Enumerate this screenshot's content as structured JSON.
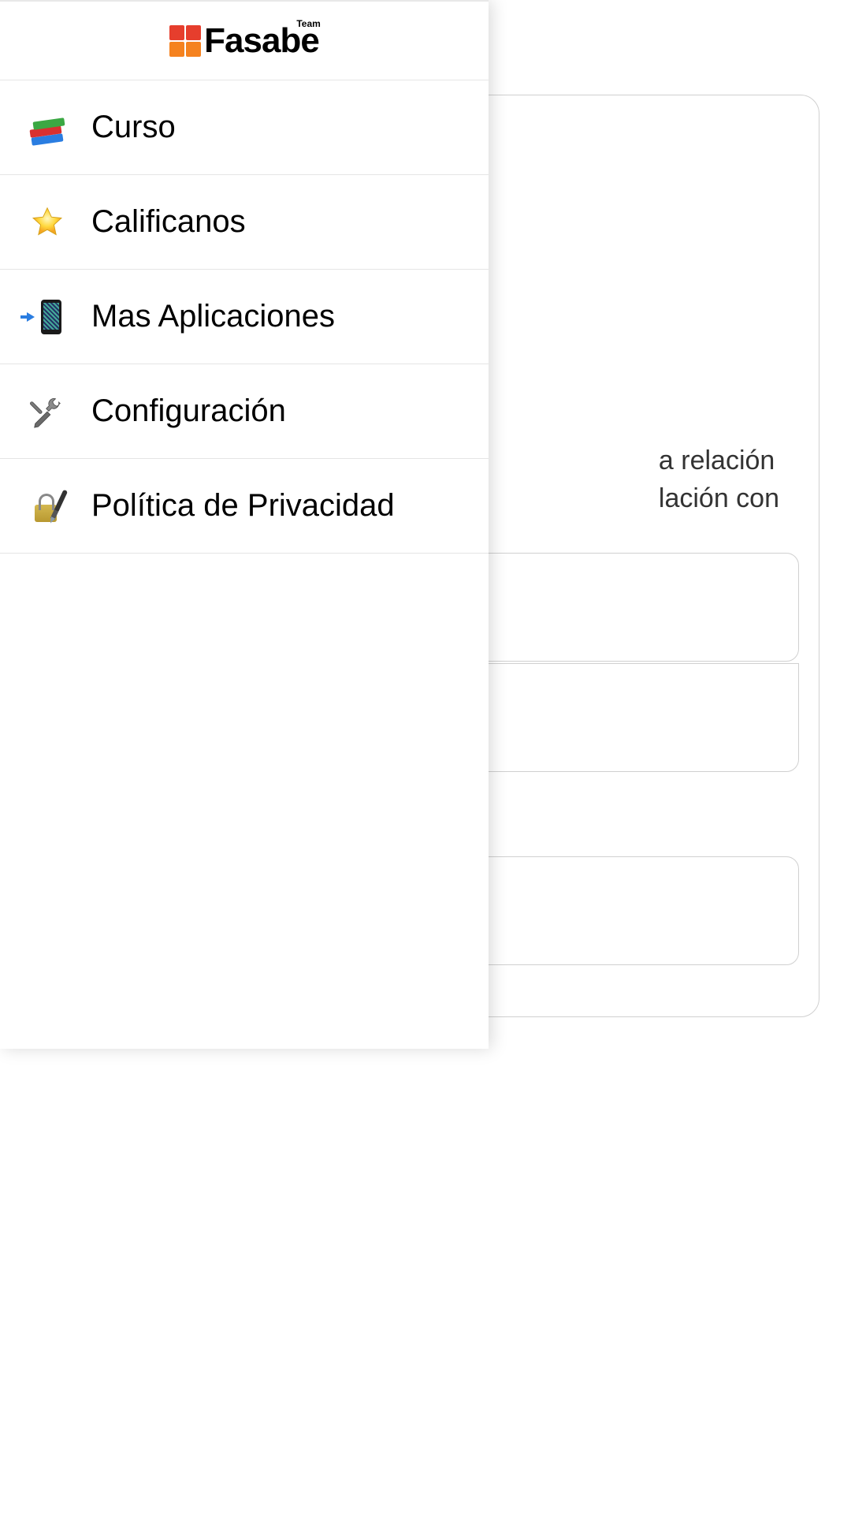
{
  "brand": {
    "name": "Fasabe",
    "tag": "Team"
  },
  "menu": {
    "items": [
      {
        "label": "Curso",
        "icon": "books-icon"
      },
      {
        "label": "Calificanos",
        "icon": "star-icon"
      },
      {
        "label": "Mas Aplicaciones",
        "icon": "phone-apps-icon"
      },
      {
        "label": "Configuración",
        "icon": "tools-icon"
      },
      {
        "label": "Política de Privacidad",
        "icon": "privacy-icon"
      }
    ]
  },
  "background": {
    "text_line1": "a relación",
    "text_line2": "lación con"
  }
}
